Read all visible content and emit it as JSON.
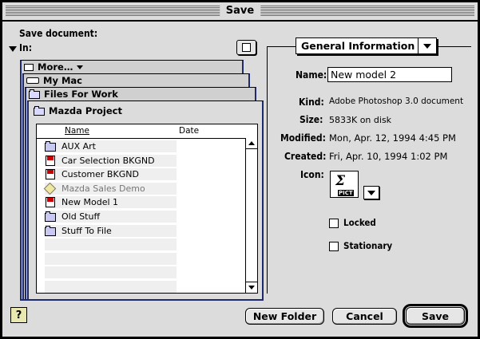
{
  "window": {
    "title": "Save"
  },
  "dialog": {
    "save_document_label": "Save document:",
    "in_label": "In:"
  },
  "folders": {
    "more": "More…",
    "my_mac": "My Mac",
    "files_for_work": "Files For Work",
    "current": "Mazda Project"
  },
  "list": {
    "col_name": "Name",
    "col_date": "Date",
    "items": [
      {
        "name": "AUX Art",
        "icon": "folder-icon"
      },
      {
        "name": "Car Selection BKGND",
        "icon": "document-icon"
      },
      {
        "name": "Customer BKGND",
        "icon": "document-icon"
      },
      {
        "name": "Mazda Sales Demo",
        "icon": "alias-icon"
      },
      {
        "name": "New Model 1",
        "icon": "document-icon"
      },
      {
        "name": "Old Stuff",
        "icon": "folder-icon"
      },
      {
        "name": "Stuff To File",
        "icon": "folder-icon"
      }
    ]
  },
  "info": {
    "popup": "General Information",
    "name_label": "Name:",
    "name_value": "New model 2",
    "kind_label": "Kind:",
    "kind_value": "Adobe Photoshop 3.0 document",
    "size_label": "Size:",
    "size_value": "5833K on disk",
    "modified_label": "Modified:",
    "modified_value": "Mon, Apr. 12, 1994  4:45 PM",
    "created_label": "Created:",
    "created_value": "Fri, Apr. 10, 1994  1:02 PM",
    "icon_label": "Icon:",
    "icon_badge": "PICT",
    "locked_label": "Locked",
    "stationary_label": "Stationary"
  },
  "buttons": {
    "help": "?",
    "new_folder": "New Folder",
    "cancel": "Cancel",
    "save": "Save"
  }
}
